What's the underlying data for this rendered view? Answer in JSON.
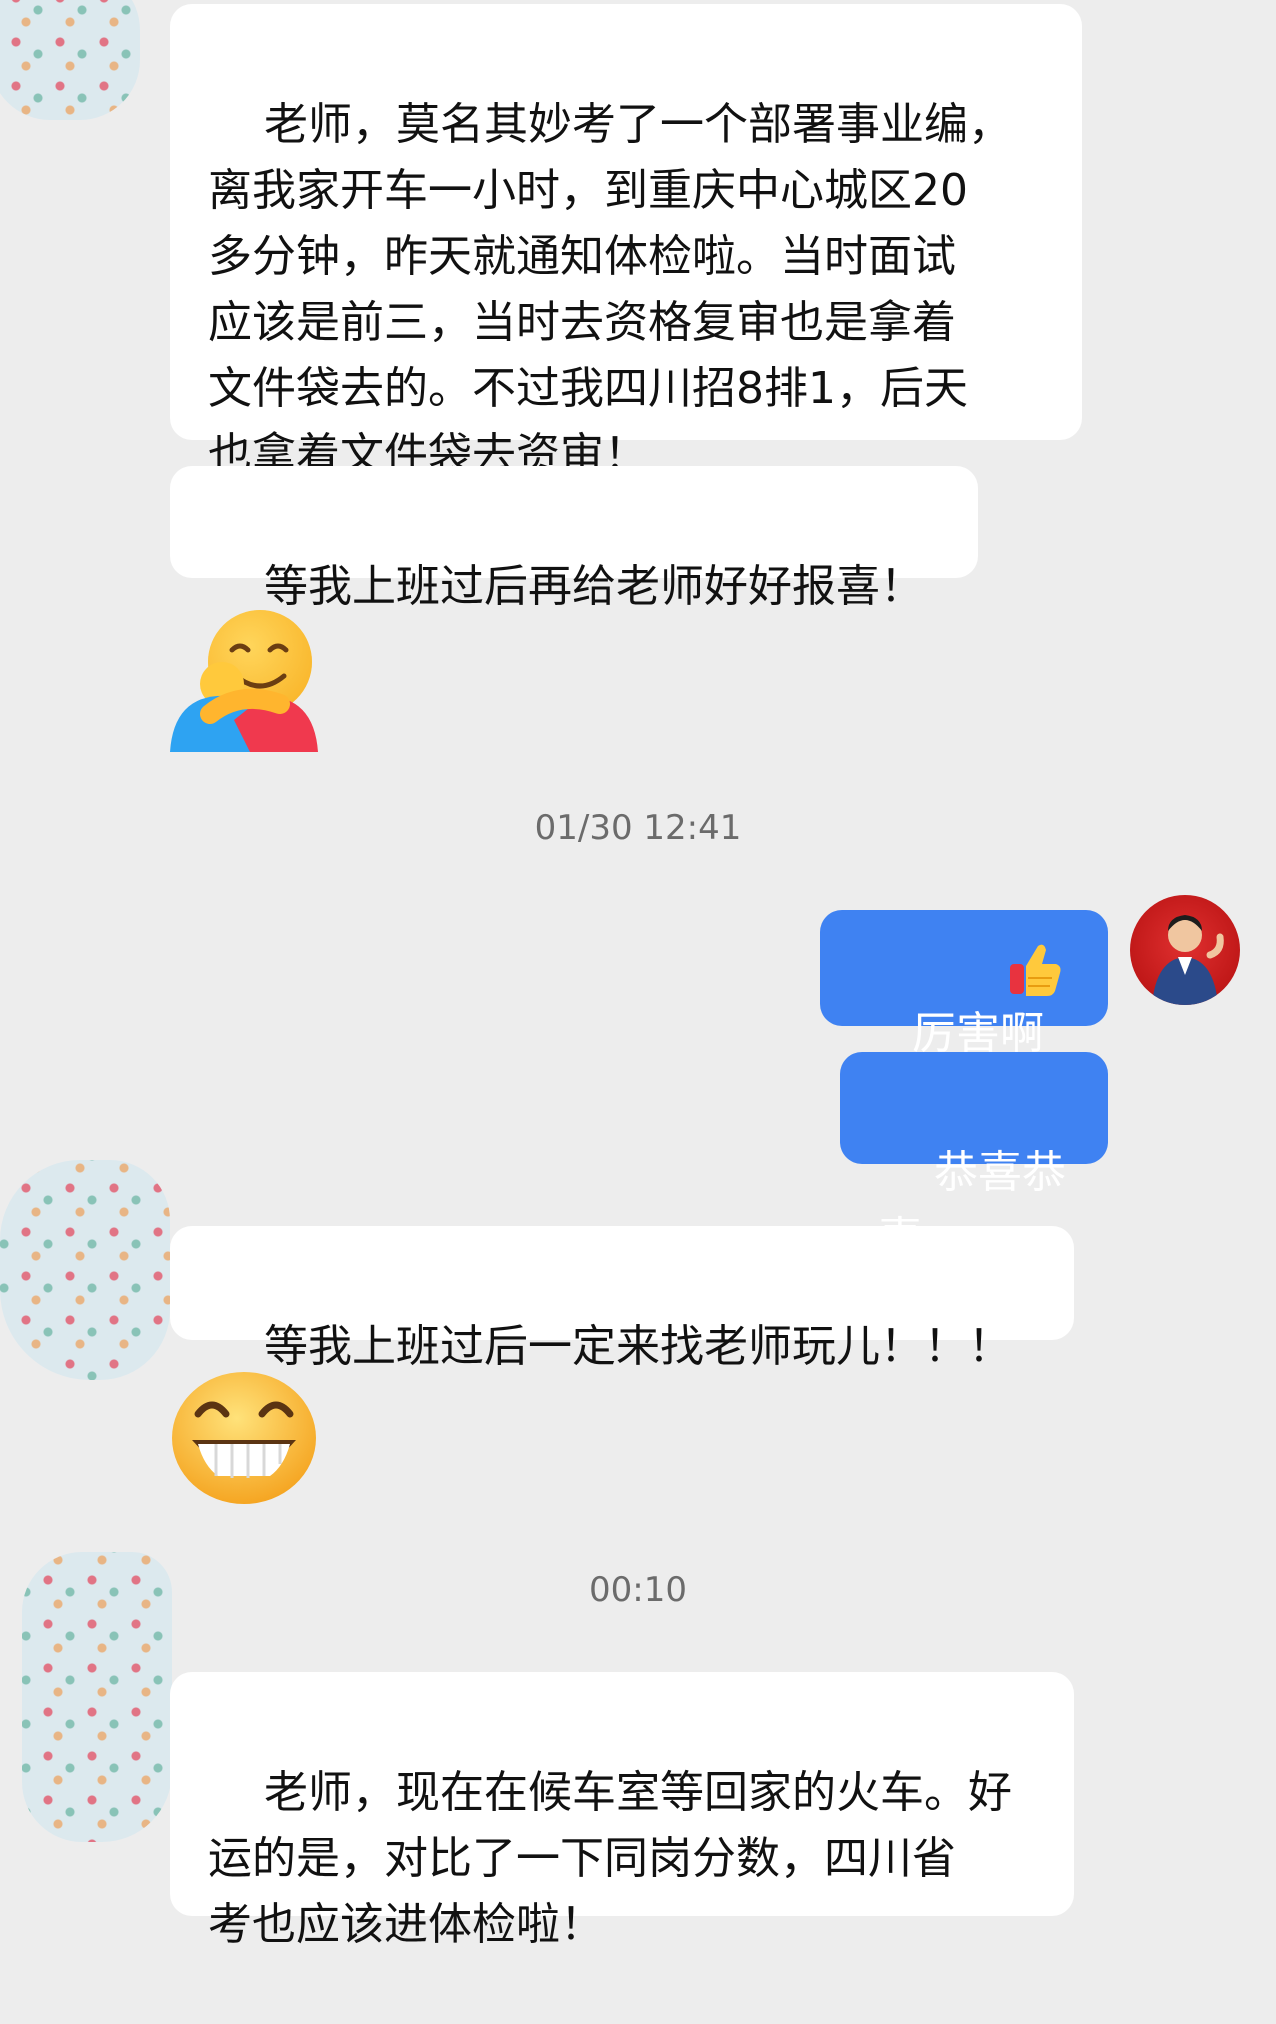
{
  "messages": [
    {
      "text": "老师，莫名其妙考了一个部署事业编，\n离我家开车一小时，到重庆中心城区20\n多分钟，昨天就通知体检啦。当时面试\n应该是前三，当时去资格复审也是拿着\n文件袋去的。不过我四川招8排1，后天\n也拿着文件袋去资审！"
    },
    {
      "text": "等我上班过后再给老师好好报喜！"
    },
    {
      "text": "厉害啊"
    },
    {
      "text": "恭喜恭喜"
    },
    {
      "text": "等我上班过后一定来找老师玩儿！！！"
    },
    {
      "text": "老师，现在在候车室等回家的火车。好\n运的是，对比了一下同岗分数，四川省\n考也应该进体检啦！"
    }
  ],
  "timestamps": [
    "01/30 12:41",
    "00:10"
  ],
  "emojis": {
    "hug": "hugging-face-emoji",
    "grin": "grinning-face-emoji",
    "thumbs_up": "thumbs-up-emoji"
  },
  "colors": {
    "background": "#ededed",
    "received_bubble": "#ffffff",
    "sent_bubble": "#3f82f2"
  }
}
